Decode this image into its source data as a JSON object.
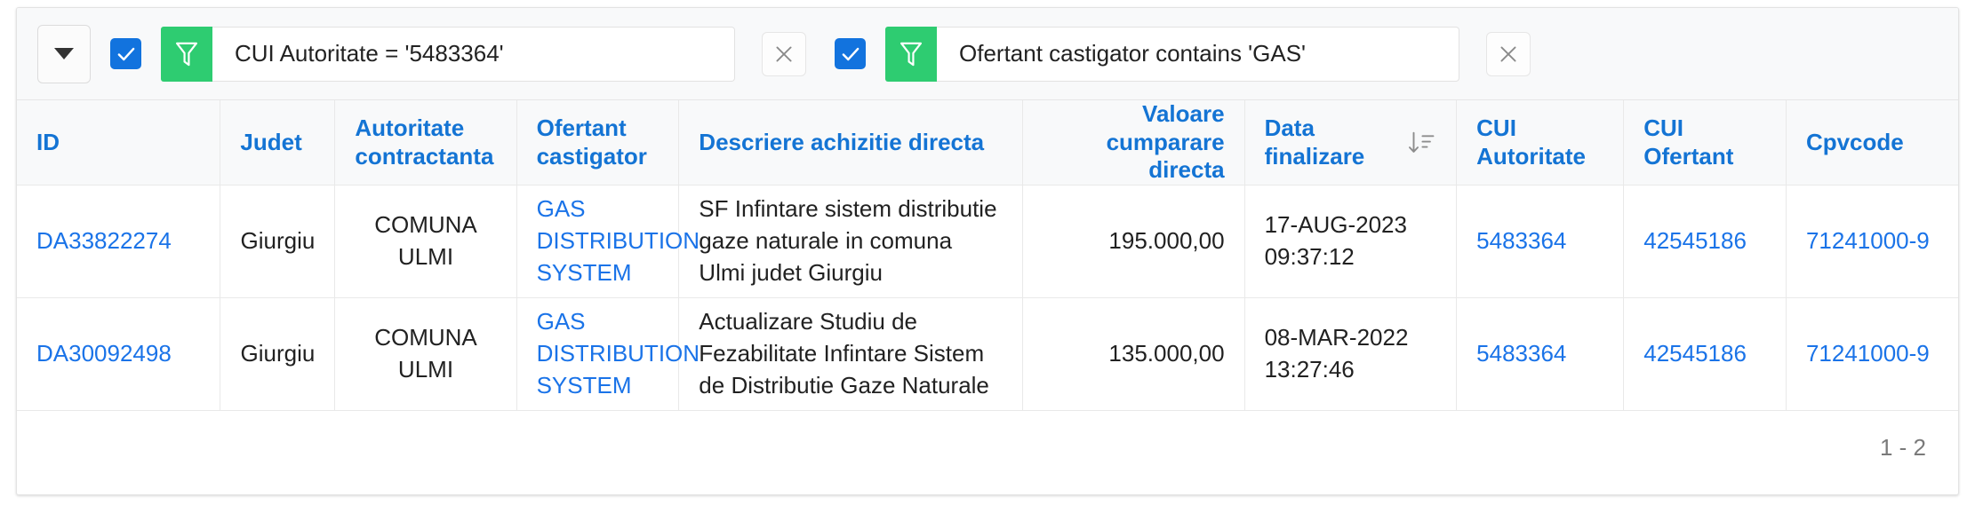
{
  "colors": {
    "link": "#1a73e8",
    "header_text": "#1474d4",
    "checkbox_blue": "#1273de",
    "funnel_green": "#2ecc71",
    "toolbar_bg": "#f8f9fa",
    "border": "#e9e9e9"
  },
  "toolbar": {
    "dropdown_button": {
      "icon": "caret-down-icon",
      "label": ""
    },
    "filters": [
      {
        "enabled": true,
        "checkbox_icon": "checkmark-icon",
        "funnel_icon": "funnel-icon",
        "expression": "CUI Autoritate = '5483364'",
        "placeholder": "Filter expression",
        "clear_icon": "close-icon"
      },
      {
        "enabled": true,
        "checkbox_icon": "checkmark-icon",
        "funnel_icon": "funnel-icon",
        "expression": "Ofertant castigator contains 'GAS'",
        "placeholder": "Filter expression",
        "clear_icon": "close-icon"
      }
    ]
  },
  "table": {
    "columns": [
      {
        "label": "ID",
        "align": "left",
        "sorted": false
      },
      {
        "label": "Judet",
        "align": "left",
        "sorted": false
      },
      {
        "label": "Autoritate contractanta",
        "align": "left",
        "sorted": false
      },
      {
        "label": "Ofertant castigator",
        "align": "left",
        "sorted": false
      },
      {
        "label": "Descriere achizitie directa",
        "align": "left",
        "sorted": false
      },
      {
        "label": "Valoare cumparare directa",
        "align": "right",
        "sorted": false
      },
      {
        "label": "Data finalizare",
        "align": "left",
        "sorted": true,
        "sort_icon": "sort-descending-icon"
      },
      {
        "label": "CUI Autoritate",
        "align": "left",
        "sorted": false
      },
      {
        "label": "CUI Ofertant",
        "align": "left",
        "sorted": false
      },
      {
        "label": "Cpvcode",
        "align": "left",
        "sorted": false
      }
    ],
    "rows": [
      {
        "id": "DA33822274",
        "judet": "Giurgiu",
        "autoritate_contractanta": "COMUNA ULMI",
        "ofertant_castigator": "GAS DISTRIBUTION SYSTEM",
        "descriere": "SF Infintare sistem distributie gaze naturale in comuna Ulmi judet Giurgiu",
        "valoare": "195.000,00",
        "data_finalizare": "17-AUG-2023 09:37:12",
        "cui_autoritate": "5483364",
        "cui_ofertant": "42545186",
        "cpvcode": "71241000-9"
      },
      {
        "id": "DA30092498",
        "judet": "Giurgiu",
        "autoritate_contractanta": "COMUNA ULMI",
        "ofertant_castigator": "GAS DISTRIBUTION SYSTEM",
        "descriere": "Actualizare Studiu de Fezabilitate Infintare Sistem de Distributie Gaze Naturale",
        "valoare": "135.000,00",
        "data_finalizare": "08-MAR-2022 13:27:46",
        "cui_autoritate": "5483364",
        "cui_ofertant": "42545186",
        "cpvcode": "71241000-9"
      }
    ]
  },
  "footer": {
    "pagination": "1 - 2"
  }
}
